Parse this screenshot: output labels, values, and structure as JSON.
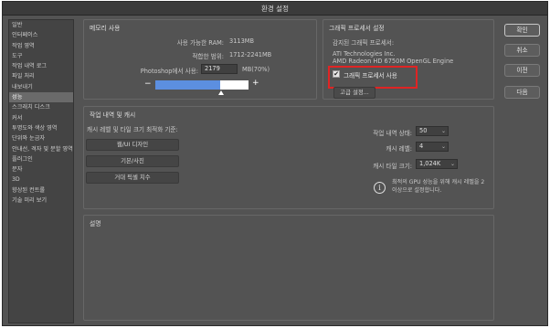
{
  "window": {
    "title": "환경 설정"
  },
  "sidebar": {
    "items": [
      {
        "label": "일반"
      },
      {
        "label": "인터페이스"
      },
      {
        "label": "작업 영역"
      },
      {
        "label": "도구"
      },
      {
        "label": "작업 내역 로그"
      },
      {
        "label": "파일 처리"
      },
      {
        "label": "내보내기"
      },
      {
        "label": "성능",
        "selected": true
      },
      {
        "label": "스크래치 디스크"
      },
      {
        "label": "커서"
      },
      {
        "label": "투명도와 색상 영역"
      },
      {
        "label": "단위와 눈금자"
      },
      {
        "label": "안내선, 격자 및 분할 영역"
      },
      {
        "label": "플러그인"
      },
      {
        "label": "문자"
      },
      {
        "label": "3D"
      },
      {
        "label": "향상된 컨트롤"
      },
      {
        "label": "기술 미리 보기"
      }
    ]
  },
  "memory": {
    "title": "메모리 사용",
    "available_label": "사용 가능한 RAM:",
    "available_value": "3113MB",
    "range_label": "적합한 범위:",
    "range_value": "1712-2241MB",
    "use_label": "Photoshop에서 사용:",
    "use_value": "2179",
    "use_unit": "MB(70%)",
    "minus": "−",
    "plus": "+",
    "slider_fraction": 0.7
  },
  "gpu": {
    "title": "그래픽 프로세서 설정",
    "detected_label": "감지된 그래픽 프로세서:",
    "vendor": "ATI Technologies Inc.",
    "model": "AMD Radeon HD 6750M OpenGL Engine",
    "use_gpu_label": "그래픽 프로세서 사용",
    "use_gpu_checked": true,
    "check_mark": "✔",
    "advanced_button": "고급 설정..."
  },
  "history": {
    "title": "작업 내역 및 캐시",
    "optimize_label": "캐시 레벨 및 타일 크기 최적화 기준:",
    "buttons": [
      "웹/UI 디자인",
      "기본/사진",
      "거대 픽셀 치수"
    ],
    "states_label": "작업 내역 상태:",
    "states_value": "50",
    "cache_levels_label": "캐시 레벨:",
    "cache_levels_value": "4",
    "tile_size_label": "캐시 타일 크기:",
    "tile_size_value": "1,024K",
    "info_icon": "i",
    "info_line1": "최적의 GPU 성능을 위해 캐시 레벨을 2",
    "info_line2": "이상으로 설정합니다.",
    "chevron": "⌄"
  },
  "description": {
    "title": "설명"
  },
  "actions": {
    "ok": "확인",
    "cancel": "취소",
    "prev": "이전",
    "next": "다음"
  }
}
